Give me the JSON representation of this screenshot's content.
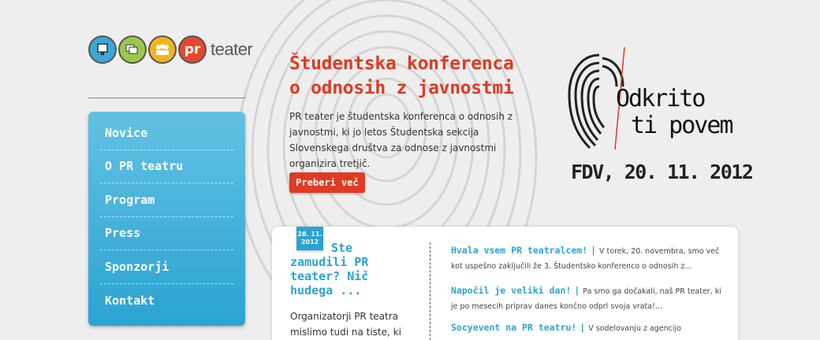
{
  "logo": {
    "word": "teater",
    "badge": "pr"
  },
  "nav": {
    "items": [
      {
        "label": "Novice"
      },
      {
        "label": "O PR teatru"
      },
      {
        "label": "Program"
      },
      {
        "label": "Press"
      },
      {
        "label": "Sponzorji"
      },
      {
        "label": "Kontakt"
      }
    ]
  },
  "hero": {
    "title": "Študentska konferenca o odnosih z javnostmi",
    "text": "PR teater je študentska konferenca o odnosih z javnostmi, ki jo letos Študentska sekcija Slovenskega društva za odnose z javnostmi organizira tretjič.",
    "button": "Preberi več"
  },
  "promo": {
    "line1": "Odkrito",
    "line2": "ti povem",
    "date": "FDV, 20. 11. 2012"
  },
  "featured": {
    "date_day": "28. 11.",
    "date_year": "2012",
    "title": "Ste zamudili PR teater? Nič hudega ...",
    "text": "Organizatorji PR teatra mislimo tudi na tiste, ki ste"
  },
  "news": [
    {
      "title": "Hvala vsem PR teatralcem!",
      "excerpt": "V torek, 20. novembra, smo več kot uspešno zaključili že 3. Študentsko konferenco o odnosih z..."
    },
    {
      "title": "Napočil je veliki dan!",
      "excerpt": "Pa smo ga dočakali, naš PR teater, ki je po mesecih priprav danes končno odprl svoja vrata!..."
    },
    {
      "title": "Socyevent na PR teatru!",
      "excerpt": "V sodelovanju z agencijo"
    }
  ],
  "colors": {
    "accent_red": "#e03a22",
    "accent_blue": "#2ba3d2",
    "background": "#eeeeee"
  }
}
